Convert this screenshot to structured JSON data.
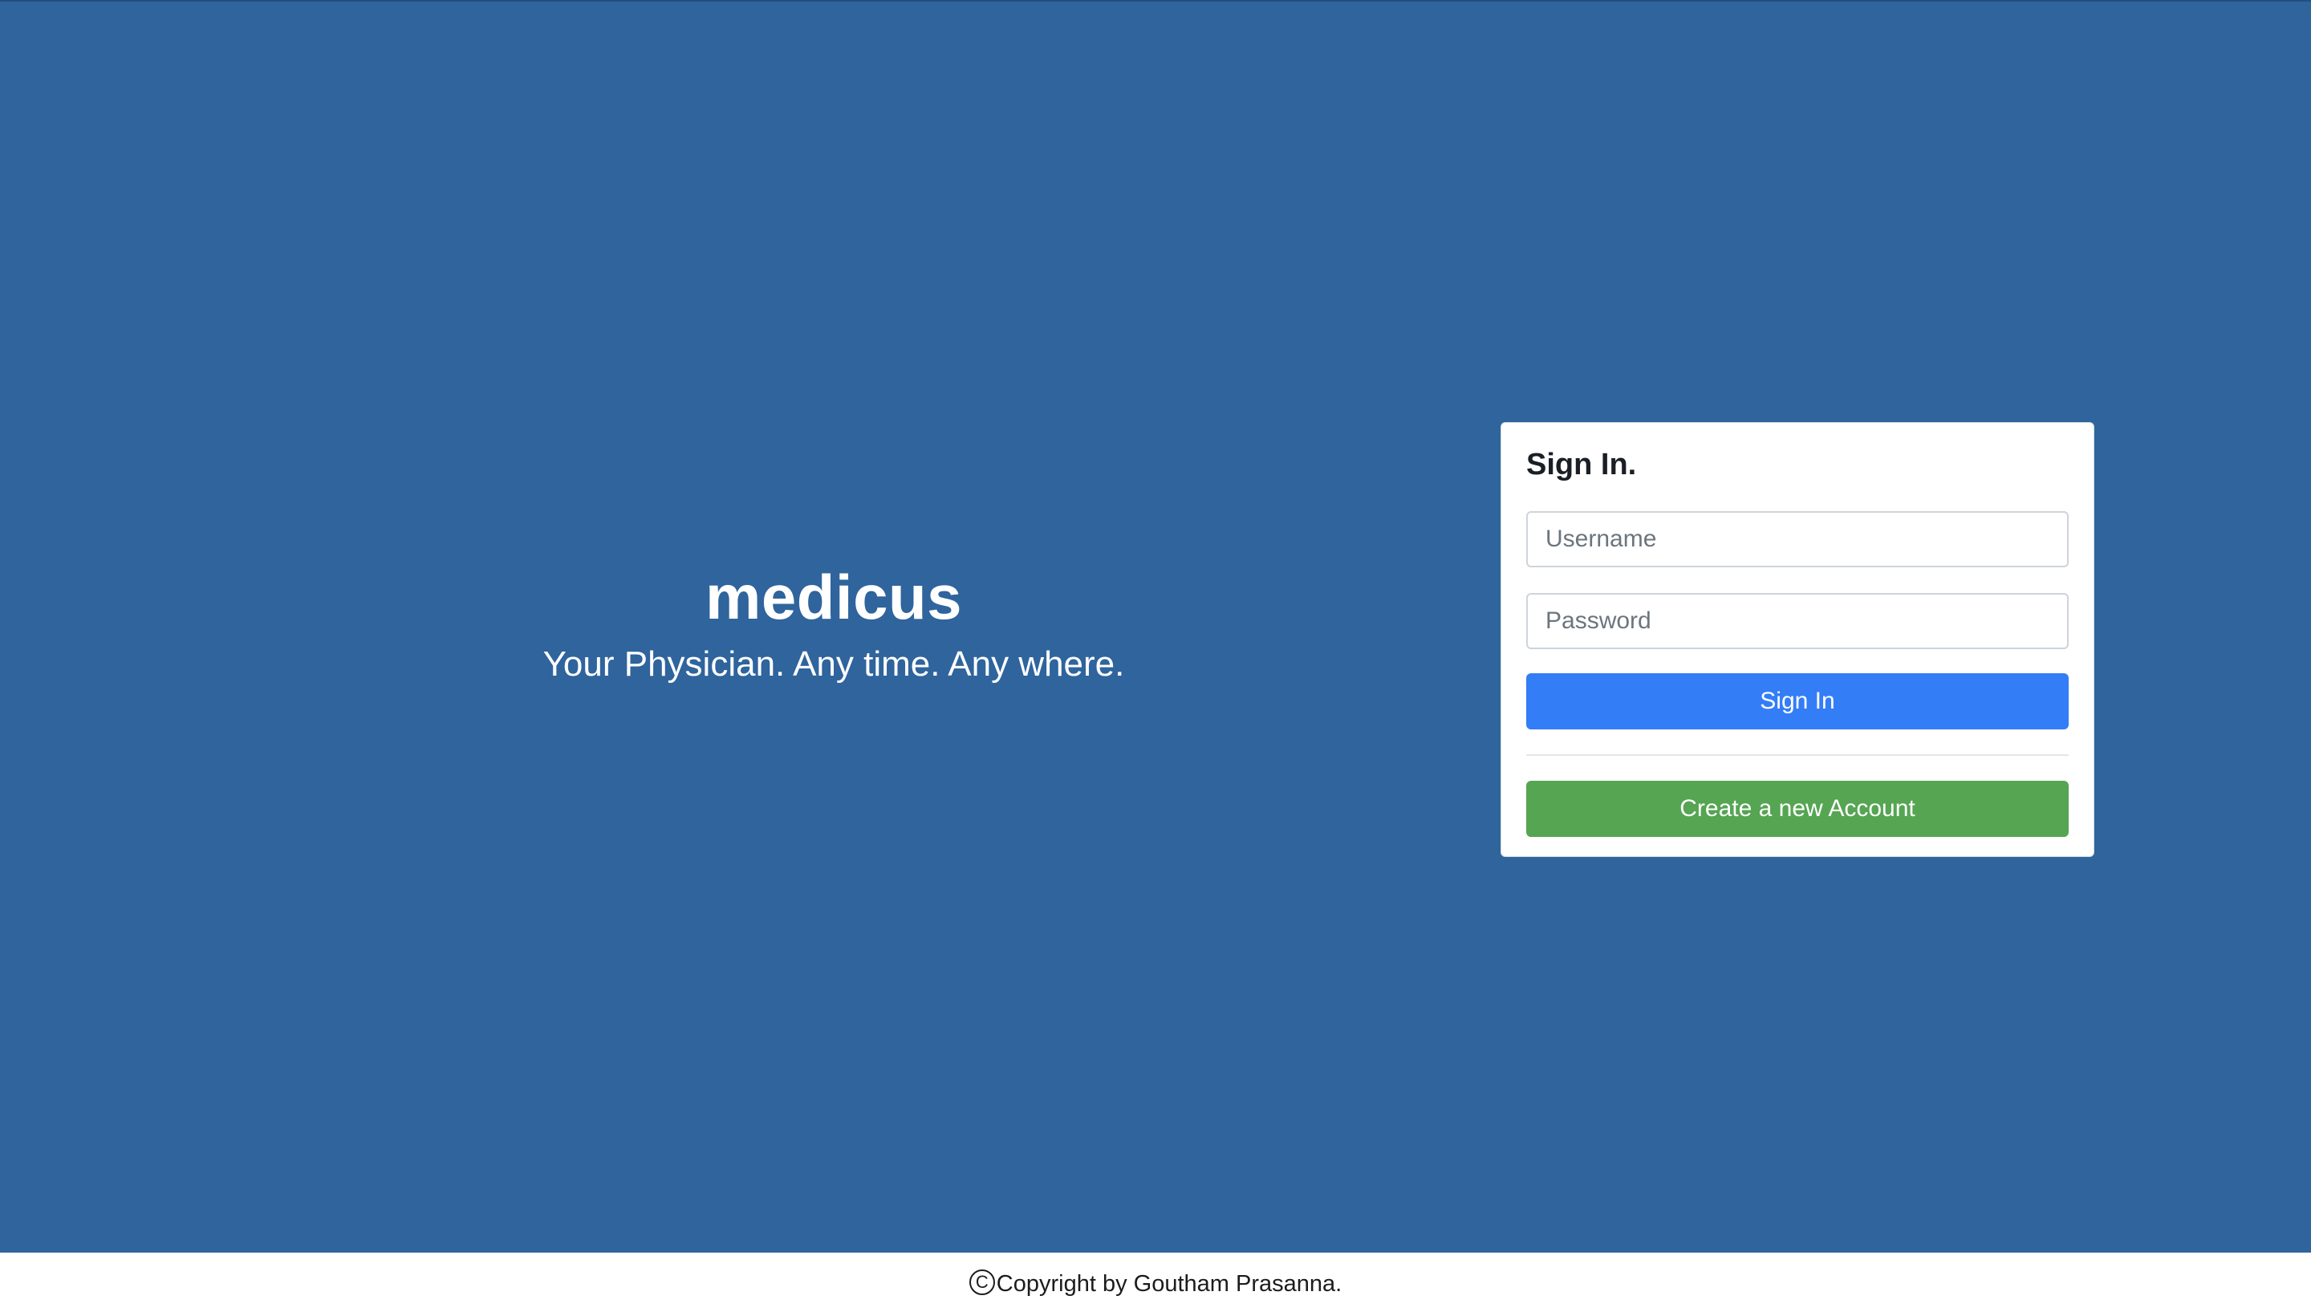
{
  "brand": {
    "title": "medicus",
    "tagline": "Your Physician. Any time. Any where."
  },
  "signin": {
    "heading": "Sign In.",
    "username_placeholder": "Username",
    "password_placeholder": "Password",
    "signin_label": "Sign In",
    "create_account_label": "Create a new Account"
  },
  "footer": {
    "copyright_icon": "copyright-icon",
    "copyright_glyph": "C",
    "text": "Copyright by Goutham Prasanna."
  },
  "colors": {
    "hero_background": "#2f649d",
    "primary_button": "#337df7",
    "success_button": "#55a552",
    "card_background": "#ffffff"
  }
}
